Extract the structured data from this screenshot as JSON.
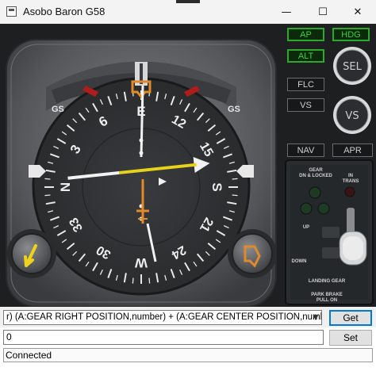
{
  "window": {
    "title": "Asobo Baron G58",
    "minimize_glyph": "—",
    "maximize_glyph": "☐",
    "close_glyph": "✕"
  },
  "hsi": {
    "cardinals": [
      "N",
      "3",
      "6",
      "E",
      "12",
      "15",
      "S",
      "21",
      "24",
      "W",
      "30",
      "33"
    ],
    "gs_left": "GS",
    "gs_right": "GS"
  },
  "autopilot": {
    "ap": "AP",
    "hdg": "HDG",
    "alt": "ALT",
    "sel": "SEL",
    "flc": "FLC",
    "vs_button": "VS",
    "vs_knob": "VS",
    "nav": "NAV",
    "apr": "APR"
  },
  "gear_panel": {
    "title_line1": "GEAR",
    "title_line2": "DN & LOCKED",
    "in_trans_line1": "IN",
    "in_trans_line2": "TRANS",
    "up": "UP",
    "down": "DOWN",
    "landing_gear": "LANDING  GEAR",
    "park_line1": "PARK BRAKE",
    "park_line2": "PULL ON"
  },
  "controls": {
    "expression": "r) (A:GEAR RIGHT POSITION,number) + (A:GEAR CENTER POSITION,number) +",
    "get_label": "Get",
    "value": "0",
    "set_label": "Set",
    "status": "Connected"
  },
  "colors": {
    "accent_green": "#39d23a",
    "needle_yellow": "#e6d21a",
    "bug_orange": "#e08a2a",
    "focus_blue": "#0078d7"
  }
}
